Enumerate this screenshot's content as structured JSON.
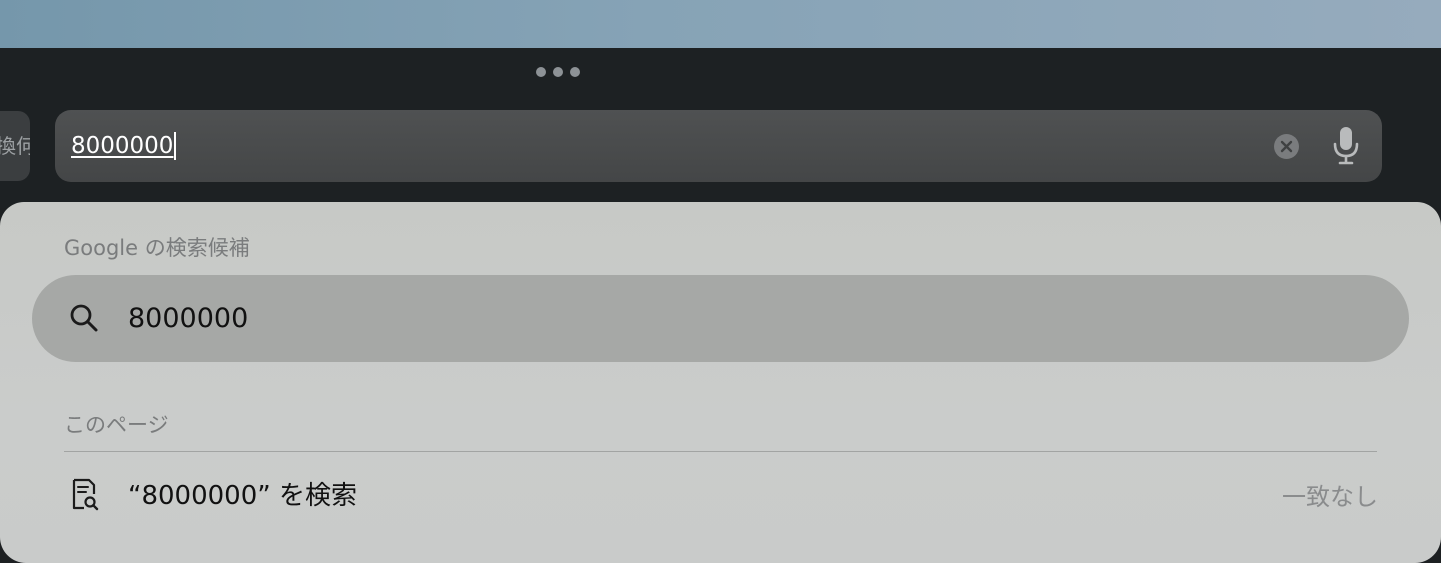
{
  "browser": {
    "previous_tab_label": "換何",
    "address_bar": {
      "value": "8000000",
      "clear_icon": "x-circle-icon",
      "voice_icon": "microphone-icon"
    }
  },
  "suggestions": {
    "google_section": {
      "header": "Google の検索候補",
      "items": [
        {
          "icon": "search-icon",
          "text": "8000000"
        }
      ]
    },
    "this_page_section": {
      "header": "このページ",
      "find_item": {
        "icon": "find-in-page-icon",
        "text": "“8000000” を検索",
        "status": "一致なし"
      }
    }
  },
  "colors": {
    "panel_background": "#c9cbca",
    "highlight_row": "#a6a8a6",
    "address_field": "#4b4d4e",
    "toolbar_background": "#1d2123"
  }
}
